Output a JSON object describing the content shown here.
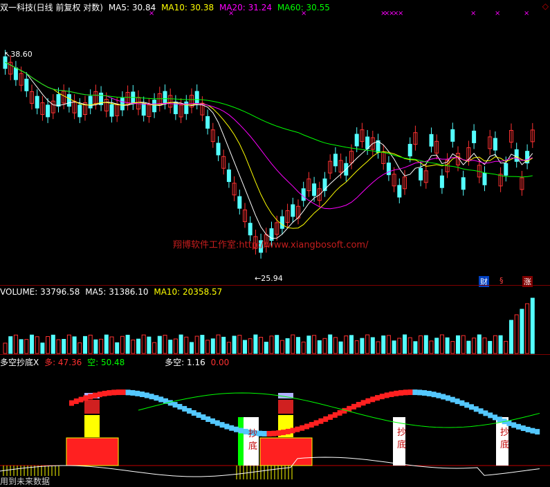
{
  "main": {
    "title": "双一科技(日线 前复权 对数)",
    "ma5_label": "MA5: 30.84",
    "ma10_label": "MA10: 30.38",
    "ma20_label": "MA20: 31.24",
    "ma60_label": "MA60: 30.55",
    "high_label": "38.60",
    "low_label": "25.94",
    "watermark": "翔博软件工作室:http://www.xiangbosoft.com/",
    "badges": [
      "财",
      "§",
      "涨"
    ],
    "colors": {
      "ma5": "#ffffff",
      "ma10": "#ffff00",
      "ma20": "#ff00ff",
      "ma60": "#00ff00",
      "up": "#ff3232",
      "down": "#54ffff"
    }
  },
  "volume": {
    "label": "VOLUME: 33796.58",
    "ma5_label": "MA5: 31386.10",
    "ma10_label": "MA10: 20358.57"
  },
  "indicator": {
    "title": "多空抄底X",
    "duo_label": "多: 47.36",
    "kong_label": "空: 50.48",
    "duokong_label": "多空: 1.16",
    "zero_label": "0.00",
    "chaodi_text": "抄底"
  },
  "footer": "用到未来数据"
}
